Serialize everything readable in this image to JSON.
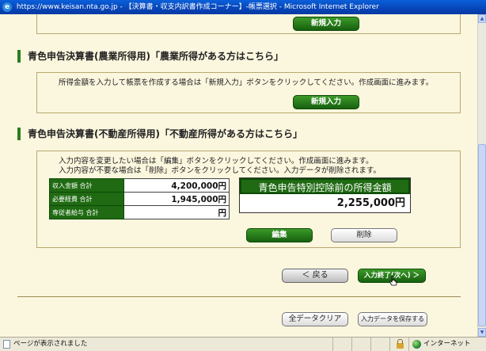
{
  "window": {
    "title": "https://www.keisan.nta.go.jp - 【決算書・収支内訳書作成コーナー】-帳票選択 - Microsoft Internet Explorer"
  },
  "top_section": {
    "new_entry_button": "新規入力"
  },
  "agri_section": {
    "heading": "青色申告決算書(農業所得用)「農業所得がある方はこちら」",
    "instruction": "所得金額を入力して帳票を作成する場合は「新規入力」ボタンをクリックしてください。作成画面に進みます。",
    "new_entry_button": "新規入力"
  },
  "realestate_section": {
    "heading": "青色申告決算書(不動産所得用)「不動産所得がある方はこちら」",
    "instruction_1": "入力内容を変更したい場合は「編集」ボタンをクリックしてください。作成画面に進みます。",
    "instruction_2": "入力内容が不要な場合は「削除」ボタンをクリックしてください。入力データが削除されます。",
    "rows": [
      {
        "label": "収入金額 合計",
        "value": "4,200,000円"
      },
      {
        "label": "必要経費 合計",
        "value": "1,945,000円"
      },
      {
        "label": "専従者給与 合計",
        "value": "円"
      }
    ],
    "income_box": {
      "title": "青色申告特別控除前の所得金額",
      "value": "2,255,000円"
    },
    "edit_button": "編集",
    "delete_button": "削除"
  },
  "navigation": {
    "back_button": "＜ 戻る",
    "finish_button": "入力終了(次へ) ＞",
    "clear_all_button": "全データクリア",
    "save_button": "入力データを保存する"
  },
  "status_bar": {
    "message": "ページが表示されました",
    "zone": "インターネット"
  },
  "colors": {
    "accent_green": "#1f6a12",
    "page_background": "#fbf6de",
    "title_bar": "#0745b8"
  }
}
